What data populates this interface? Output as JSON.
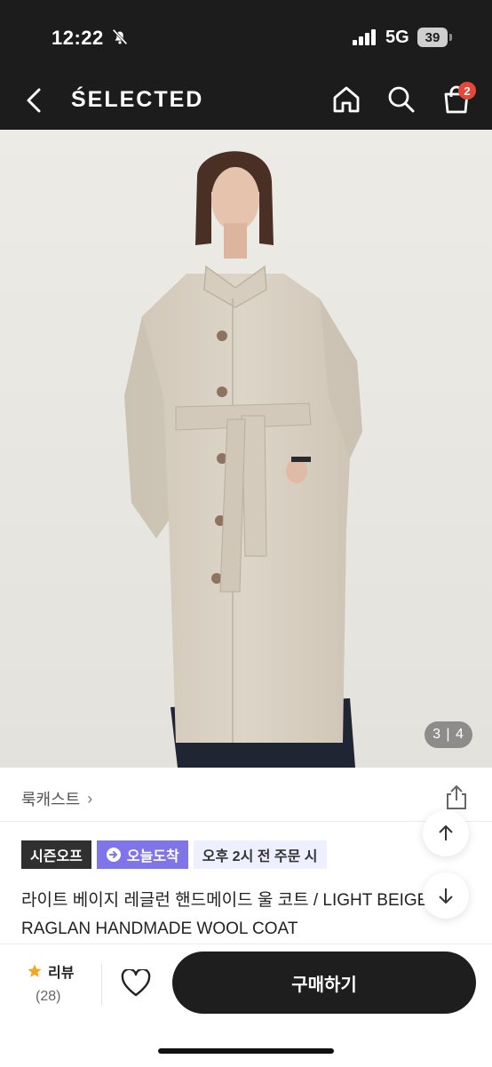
{
  "status": {
    "time": "12:22",
    "network": "5G",
    "battery": "39"
  },
  "nav": {
    "title": "ŚELECTED",
    "cart_count": "2"
  },
  "gallery": {
    "counter": "3 | 4"
  },
  "brand_link": {
    "label": "룩캐스트"
  },
  "tags": {
    "season": "시즌오프",
    "today": "오늘도착",
    "notice": "오후 2시 전 주문 시"
  },
  "product": {
    "name_line1": "라이트 베이지 레글런 핸드메이드 울 코트 / LIGHT BEIGE",
    "name_line2": "RAGLAN HANDMADE WOOL COAT"
  },
  "bottom": {
    "review_label": "리뷰",
    "review_count": "(28)",
    "buy_label": "구매하기"
  },
  "colors": {
    "dark": "#1c1c1c",
    "badge": "#e5483b",
    "purple_tag": "#7f74e8",
    "star": "#f5a623"
  }
}
